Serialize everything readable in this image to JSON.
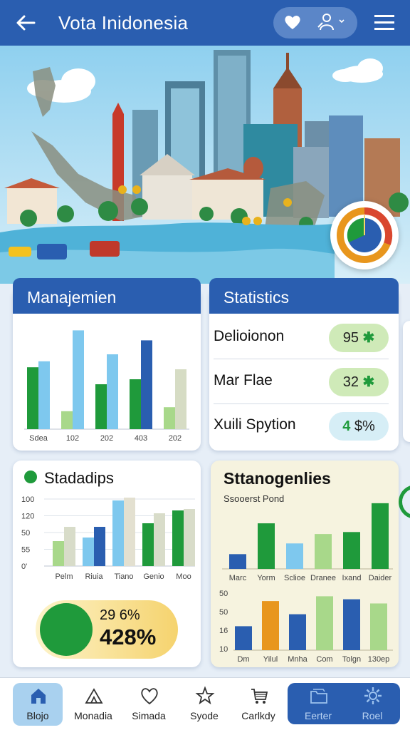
{
  "header": {
    "title": "Vota Inidonesia",
    "back_icon": "arrow-left-icon",
    "heart_icon": "heart-icon",
    "user_icon": "user-icon",
    "menu_icon": "hamburger-menu-icon"
  },
  "management": {
    "title": "Manajemien",
    "chart_data": {
      "type": "bar",
      "categories": [
        "Sdea",
        "102",
        "202",
        "403",
        "202"
      ],
      "series": [
        {
          "values": [
            62,
            18,
            45,
            50,
            22
          ]
        },
        {
          "values": [
            68,
            99,
            75,
            89,
            60
          ]
        }
      ],
      "ylim": [
        0,
        100
      ]
    }
  },
  "statistics": {
    "title": "Statistics",
    "rows": [
      {
        "label": "Delioionon",
        "value": "95",
        "symbol": "✱"
      },
      {
        "label": "Mar Flae",
        "value": "32",
        "symbol": "✱"
      },
      {
        "label": "Xuili Spytion",
        "value": "4",
        "symbol": "$%"
      }
    ]
  },
  "stadadips": {
    "title": "Stadadips",
    "chart_data": {
      "type": "bar",
      "categories": [
        "Pelm",
        "Riuia",
        "Tiano",
        "Genio",
        "Moo"
      ],
      "y_ticks": [
        "100",
        "120",
        "50",
        "55",
        "0'"
      ],
      "series": [
        {
          "values": [
            35,
            40,
            92,
            60,
            78
          ]
        },
        {
          "values": [
            55,
            55,
            96,
            74,
            80
          ]
        }
      ],
      "ylim": [
        0,
        100
      ]
    },
    "pct_small": "29 6%",
    "pct_big": "428%"
  },
  "stanogenlies": {
    "title": "Sttanogenlies",
    "subtitle": "Ssooerst Pond",
    "chart_top": {
      "type": "bar",
      "categories": [
        "Marc",
        "Yorm",
        "Sclioe",
        "Dranee",
        "Ixand",
        "Daider"
      ],
      "values": [
        22,
        68,
        38,
        52,
        55,
        98
      ],
      "ylim": [
        0,
        100
      ]
    },
    "chart_bottom": {
      "type": "bar",
      "categories": [
        "Dm",
        "Yilul",
        "Mnha",
        "Com",
        "Tolgn",
        "130ep"
      ],
      "y_ticks": [
        "50",
        "50",
        "16",
        "10"
      ],
      "values": [
        40,
        82,
        60,
        90,
        85,
        78
      ],
      "ylim": [
        0,
        100
      ]
    }
  },
  "bottom_nav": {
    "items": [
      {
        "label": "Blojo",
        "icon": "home-icon"
      },
      {
        "label": "Monadia",
        "icon": "tent-icon"
      },
      {
        "label": "Simada",
        "icon": "heart-icon"
      },
      {
        "label": "Syode",
        "icon": "star-icon"
      },
      {
        "label": "Carlkdy",
        "icon": "cart-icon"
      },
      {
        "label": "Eerter",
        "icon": "folder-icon"
      },
      {
        "label": "Roel",
        "icon": "gear-icon"
      }
    ]
  },
  "colors": {
    "primary": "#2a5eb0",
    "green": "#1f9a3b",
    "light_blue": "#7ec8ee",
    "light_green": "#a8d88a",
    "accent_orange": "#e8961d"
  }
}
